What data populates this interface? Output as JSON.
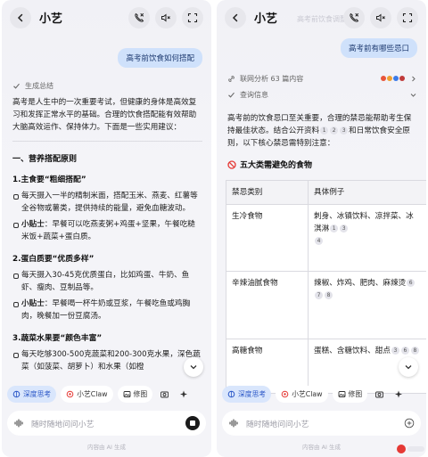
{
  "left": {
    "title": "小艺",
    "user_message": "高考前饮食如何搭配",
    "summary_label": "生成总结",
    "intro": "高考是人生中的一次重要考试，但健康的身体是高效复习和发挥正常水平的基础。合理的饮食搭配能有效帮助大脑高效运作、保持体力。下面是一些实用建议：",
    "section1": "一、营养搭配原则",
    "sub1": "1.主食要“粗细搭配”",
    "b1": "每天摄入一半的精制米面，搭配玉米、燕麦、红薯等全谷物或薯类，提供持续的能量，避免血糖波动。",
    "tip1_label": "小贴士",
    "tip1": "：早餐可以吃燕麦粥+鸡蛋+坚果，午餐吃糙米饭+蔬菜+蛋白质。",
    "sub2": "2.蛋白质要“优质多样”",
    "b2": "每天摄入30-45克优质蛋白，比如鸡蛋、牛奶、鱼虾、瘦肉、豆制品等。",
    "tip2_label": "小贴士",
    "tip2": "：早餐喝一杯牛奶或豆浆，午餐吃鱼或鸡胸肉，晚餐加一份豆腐汤。",
    "sub3": "3.蔬菜水果要“颜色丰富”",
    "b3": "每天吃够300-500克蔬菜和200-300克水果，深色蔬菜（如菠菜、胡萝卜）和水果（如橙"
  },
  "right": {
    "title": "小艺",
    "faded_hint": "高考前饮食调整建议",
    "user_message": "高考前有哪些忌口",
    "search_label": "联网分析 63 篇内容",
    "info_label": "查询信息",
    "intro_a": "高考前的饮食忌口至关重要，合理的禁忌能帮助考生保持最佳状态。结合公开资料",
    "intro_b": "和日常饮食安全原则，以下核心禁忌需特别注意：",
    "section": "五大类需避免的食物",
    "table": {
      "headers": [
        "禁忌类别",
        "具体例子"
      ],
      "rows": [
        {
          "cat": "生冷食物",
          "ex": "刺身、冰镇饮料、凉拌菜、冰淇淋",
          "cites": [
            "1",
            "3"
          ],
          "cite_after": "4"
        },
        {
          "cat": "辛辣油腻食物",
          "ex": "辣椒、炸鸡、肥肉、麻辣烫",
          "cites": [
            "6",
            "7",
            "8"
          ]
        },
        {
          "cat": "高糖食物",
          "ex": "蛋糕、含糖饮料、甜点",
          "cites": [
            "3",
            "6",
            "8"
          ]
        }
      ]
    },
    "intro_cites": [
      "1",
      "2",
      "3"
    ]
  },
  "chips": {
    "deep_think": "深度思考",
    "claw": "小艺Claw",
    "edit": "修图"
  },
  "input_placeholder": "随时随地问问小艺",
  "footer_note": "内容由 AI 生成",
  "colors": {
    "bubble": "#cfe1fb",
    "chip_active": "#d9e6fc",
    "accent": "#2a57c7",
    "warn": "#e53935"
  }
}
